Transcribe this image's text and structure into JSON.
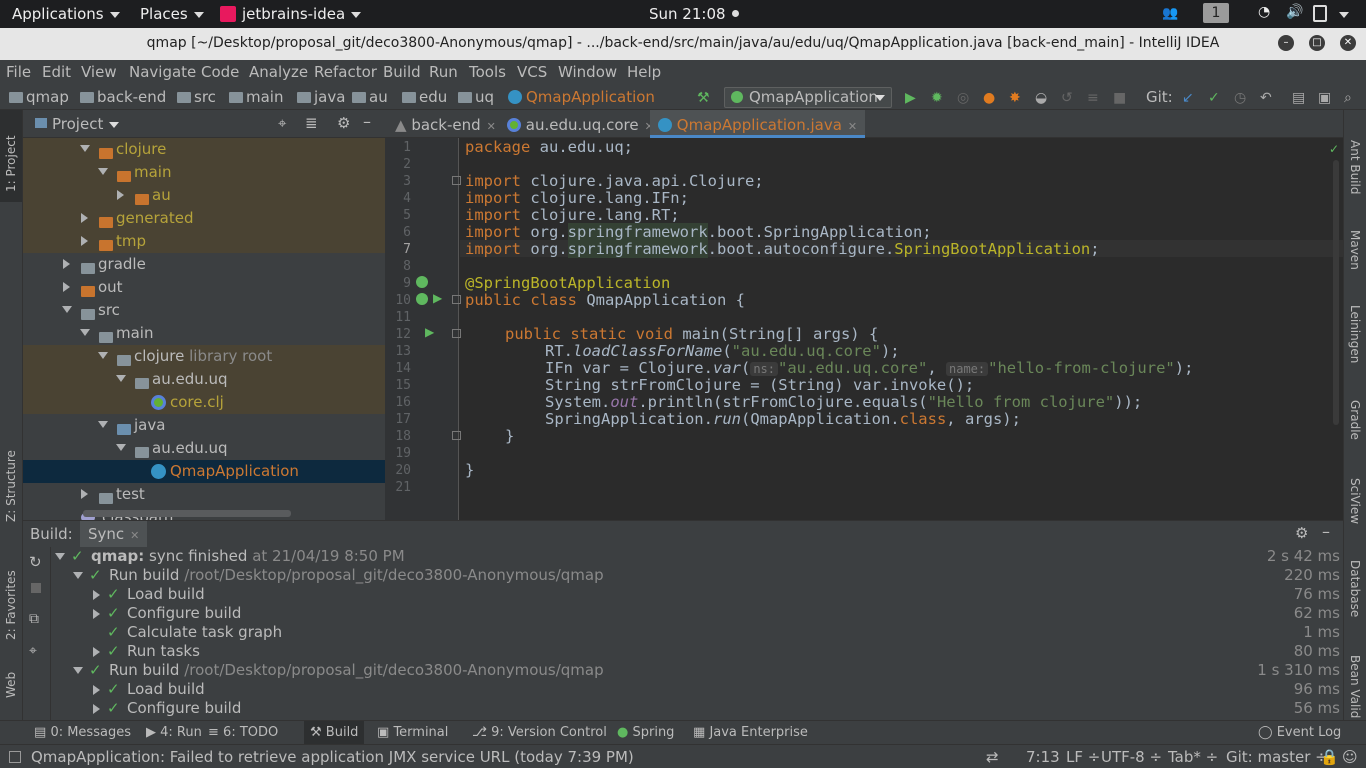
{
  "topbar": {
    "applications": "Applications",
    "places": "Places",
    "app_name": "jetbrains-idea",
    "clock": "Sun 21:08",
    "workspace": "1"
  },
  "window": {
    "title": "qmap [~/Desktop/proposal_git/deco3800-Anonymous/qmap] - .../back-end/src/main/java/au/edu/uq/QmapApplication.java [back-end_main] - IntelliJ IDEA"
  },
  "menu": {
    "items": [
      "File",
      "Edit",
      "View",
      "Navigate",
      "Code",
      "Analyze",
      "Refactor",
      "Build",
      "Run",
      "Tools",
      "VCS",
      "Window",
      "Help"
    ]
  },
  "breadcrumbs": [
    "qmap",
    "back-end",
    "src",
    "main",
    "java",
    "au",
    "edu",
    "uq",
    "QmapApplication"
  ],
  "toolbar": {
    "run_config": "QmapApplication",
    "git_label": "Git:"
  },
  "project": {
    "title": "Project",
    "tree": [
      {
        "label": "clojure",
        "suffix": ""
      },
      {
        "label": "main",
        "suffix": ""
      },
      {
        "label": "au",
        "suffix": ""
      },
      {
        "label": "generated",
        "suffix": ""
      },
      {
        "label": "tmp",
        "suffix": ""
      },
      {
        "label": "gradle",
        "suffix": ""
      },
      {
        "label": "out",
        "suffix": ""
      },
      {
        "label": "src",
        "suffix": ""
      },
      {
        "label": "main",
        "suffix": ""
      },
      {
        "label": "clojure",
        "suffix": "library root"
      },
      {
        "label": "au.edu.uq",
        "suffix": ""
      },
      {
        "label": "core.clj",
        "suffix": ""
      },
      {
        "label": "java",
        "suffix": ""
      },
      {
        "label": "au.edu.uq",
        "suffix": ""
      },
      {
        "label": "QmapApplication",
        "suffix": ""
      },
      {
        "label": "test",
        "suffix": ""
      },
      {
        "label": "classpath",
        "suffix": ""
      }
    ]
  },
  "editor": {
    "tabs": [
      "back-end",
      "au.edu.uq.core",
      "QmapApplication.java"
    ],
    "line_numbers": [
      "1",
      "2",
      "3",
      "4",
      "5",
      "6",
      "7",
      "8",
      "9",
      "10",
      "11",
      "12",
      "13",
      "14",
      "15",
      "16",
      "17",
      "18",
      "19",
      "20",
      "21"
    ],
    "code": {
      "l1_kw": "package",
      "l1_rest": " au.edu.uq;",
      "import_kw": "import",
      "l3": " clojure.java.api.Clojure;",
      "l4": " clojure.lang.IFn;",
      "l5": " clojure.lang.RT;",
      "l6a": " org.",
      "l6b": "springframework",
      "l6c": ".boot.SpringApplication;",
      "l7a": " org.",
      "l7b": "springframework",
      "l7c": ".boot.autoconfigure.",
      "l7d": "SpringBootApplication",
      "l7e": ";",
      "l9": "@SpringBootApplication",
      "l10_kw": "public class",
      "l10_rest": " QmapApplication {",
      "l12_kw": "public static void",
      "l12_rest": " main(String[] args) {",
      "l13a": "RT.",
      "l13b": "loadClassForName",
      "l13c": "(",
      "l13d": "\"au.edu.uq.core\"",
      "l13e": ");",
      "l14a": "IFn var = Clojure.",
      "l14b": "var",
      "l14c": "(",
      "l14hint1": "ns:",
      "l14d": "\"au.edu.uq.core\"",
      "l14e": ", ",
      "l14hint2": "name:",
      "l14f": "\"hello-from-clojure\"",
      "l14g": ");",
      "l15": "String strFromClojure = (String) var.invoke();",
      "l16a": "System.",
      "l16b": "out",
      "l16c": ".println(strFromClojure.equals(",
      "l16d": "\"Hello from clojure\"",
      "l16e": "));",
      "l17a": "SpringApplication.",
      "l17b": "run",
      "l17c": "(QmapApplication.",
      "l17d": "class",
      "l17e": ", args);",
      "l18": "}",
      "l20": "}"
    }
  },
  "build": {
    "label": "Build:",
    "tab": "Sync",
    "rows": [
      {
        "title": "qmap:",
        "text": "sync finished",
        "meta": "at 21/04/19 8:50 PM",
        "time": "2 s 42 ms"
      },
      {
        "title": "Run build",
        "text": "",
        "meta": "/root/Desktop/proposal_git/deco3800-Anonymous/qmap",
        "time": "220 ms"
      },
      {
        "title": "Load build",
        "text": "",
        "meta": "",
        "time": "76 ms"
      },
      {
        "title": "Configure build",
        "text": "",
        "meta": "",
        "time": "62 ms"
      },
      {
        "title": "Calculate task graph",
        "text": "",
        "meta": "",
        "time": "1 ms"
      },
      {
        "title": "Run tasks",
        "text": "",
        "meta": "",
        "time": "80 ms"
      },
      {
        "title": "Run build",
        "text": "",
        "meta": "/root/Desktop/proposal_git/deco3800-Anonymous/qmap",
        "time": "1 s 310 ms"
      },
      {
        "title": "Load build",
        "text": "",
        "meta": "",
        "time": "96 ms"
      },
      {
        "title": "Configure build",
        "text": "",
        "meta": "",
        "time": "56 ms"
      }
    ]
  },
  "tool_tabs": [
    "0: Messages",
    "4: Run",
    "6: TODO",
    "Build",
    "Terminal",
    "9: Version Control",
    "Spring",
    "Java Enterprise",
    "Event Log"
  ],
  "left_stripe": [
    "1: Project",
    "Z: Structure",
    "2: Favorites",
    "Web"
  ],
  "right_stripe": [
    "Ant Build",
    "Maven",
    "Leiningen",
    "Gradle",
    "SciView",
    "Database",
    "Bean Valid"
  ],
  "status": {
    "message": "QmapApplication: Failed to retrieve application JMX service URL (today 7:39 PM)",
    "position": "7:13",
    "line_sep": "LF ÷",
    "encoding": "UTF-8 ÷",
    "indent": "Tab* ÷",
    "git": "Git: master ÷"
  },
  "colors": {
    "accent": "#4a88c7",
    "keyword": "#cc7832",
    "string": "#6a8759",
    "annotation": "#bbb529",
    "success": "#5fb85f"
  }
}
